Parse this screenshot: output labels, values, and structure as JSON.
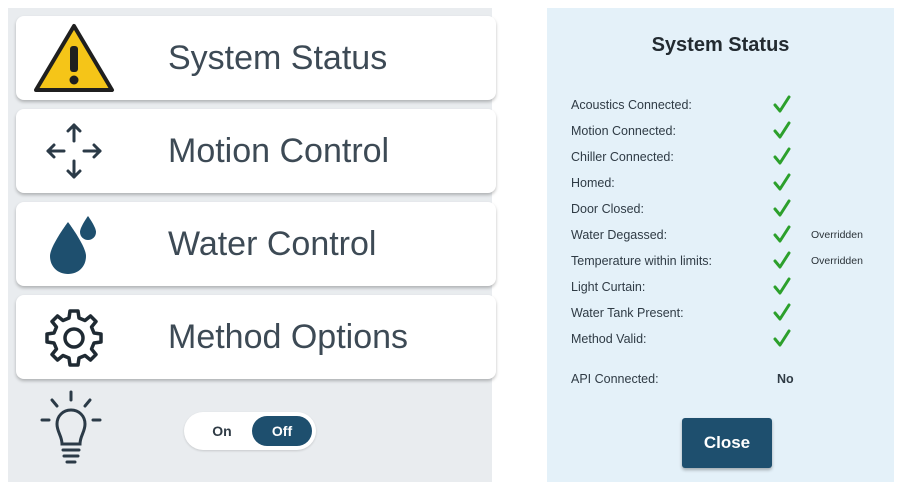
{
  "menu": {
    "items": [
      {
        "label": "System Status",
        "icon": "warning-icon"
      },
      {
        "label": "Motion Control",
        "icon": "move-arrows-icon"
      },
      {
        "label": "Water Control",
        "icon": "water-drop-icon"
      },
      {
        "label": "Method Options",
        "icon": "gear-icon"
      }
    ]
  },
  "light": {
    "icon": "light-bulb-icon",
    "toggle": {
      "on_label": "On",
      "off_label": "Off",
      "selected": "Off"
    }
  },
  "status_dialog": {
    "title": "System Status",
    "rows": [
      {
        "label": "Acoustics Connected:",
        "ok": true,
        "note": ""
      },
      {
        "label": "Motion Connected:",
        "ok": true,
        "note": ""
      },
      {
        "label": "Chiller Connected:",
        "ok": true,
        "note": ""
      },
      {
        "label": "Homed:",
        "ok": true,
        "note": ""
      },
      {
        "label": "Door Closed:",
        "ok": true,
        "note": ""
      },
      {
        "label": "Water Degassed:",
        "ok": true,
        "note": "Overridden"
      },
      {
        "label": "Temperature within limits:",
        "ok": true,
        "note": "Overridden"
      },
      {
        "label": "Light Curtain:",
        "ok": true,
        "note": ""
      },
      {
        "label": "Water Tank Present:",
        "ok": true,
        "note": ""
      },
      {
        "label": "Method Valid:",
        "ok": true,
        "note": ""
      }
    ],
    "api": {
      "label": "API Connected:",
      "value": "No"
    },
    "close_label": "Close"
  },
  "colors": {
    "accent": "#1e4f6e",
    "check": "#2ca02c",
    "warning": "#f5c518",
    "panel_bg": "#e9ecef",
    "dialog_bg": "#e4f1f9"
  }
}
